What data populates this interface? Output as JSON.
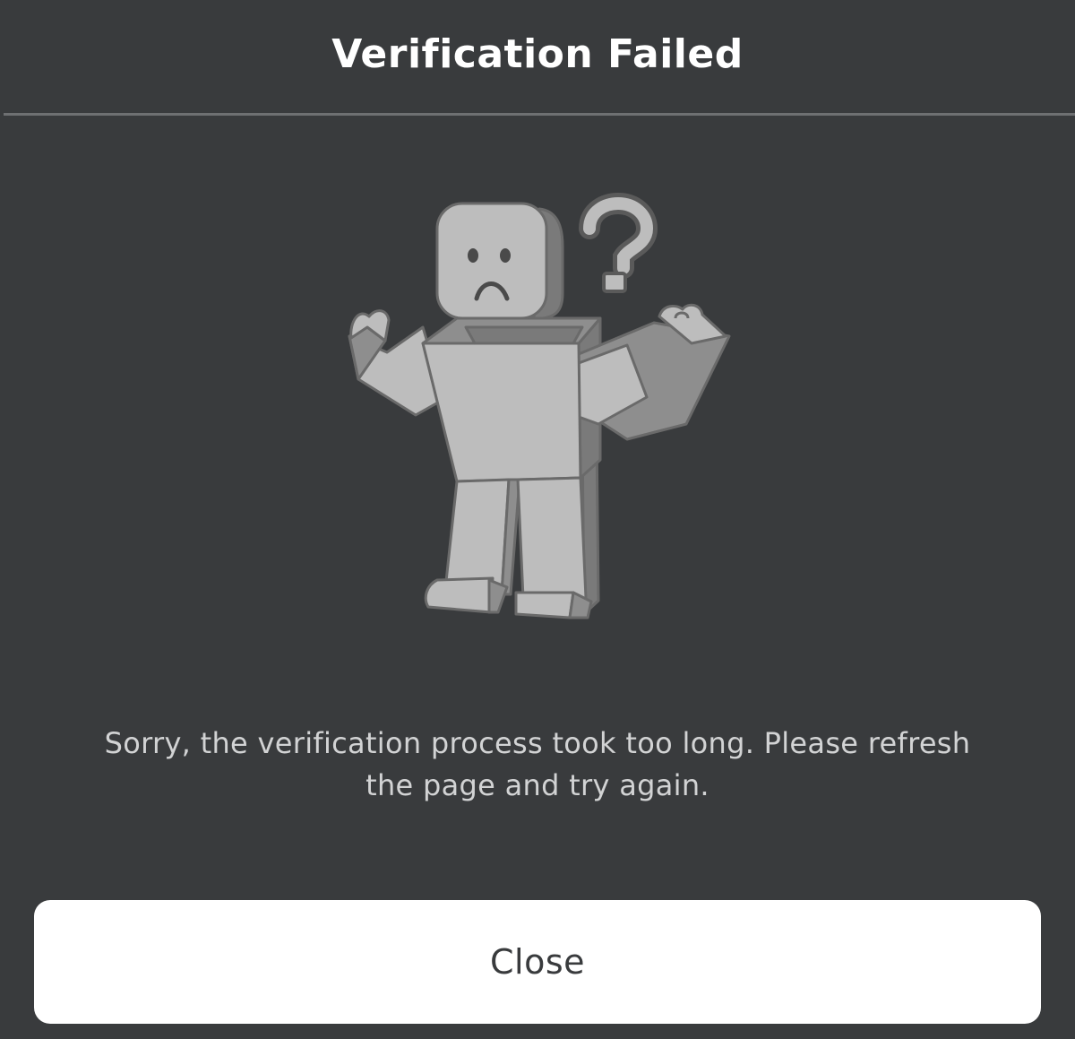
{
  "dialog": {
    "title": "Verification Failed",
    "message": "Sorry, the verification process took too long. Please refresh the page and try again.",
    "close_label": "Close"
  },
  "illustration": {
    "name": "confused-avatar-illustration",
    "icon": "question-mark-icon"
  },
  "colors": {
    "background": "#393b3d",
    "divider": "#6e7072",
    "title_text": "#ffffff",
    "message_text": "#d2d3d4",
    "button_background": "#ffffff",
    "button_text": "#393b3d",
    "figure_light": "#bdbdbd",
    "figure_mid": "#8e8e8e",
    "figure_dark": "#6f6f6f"
  }
}
